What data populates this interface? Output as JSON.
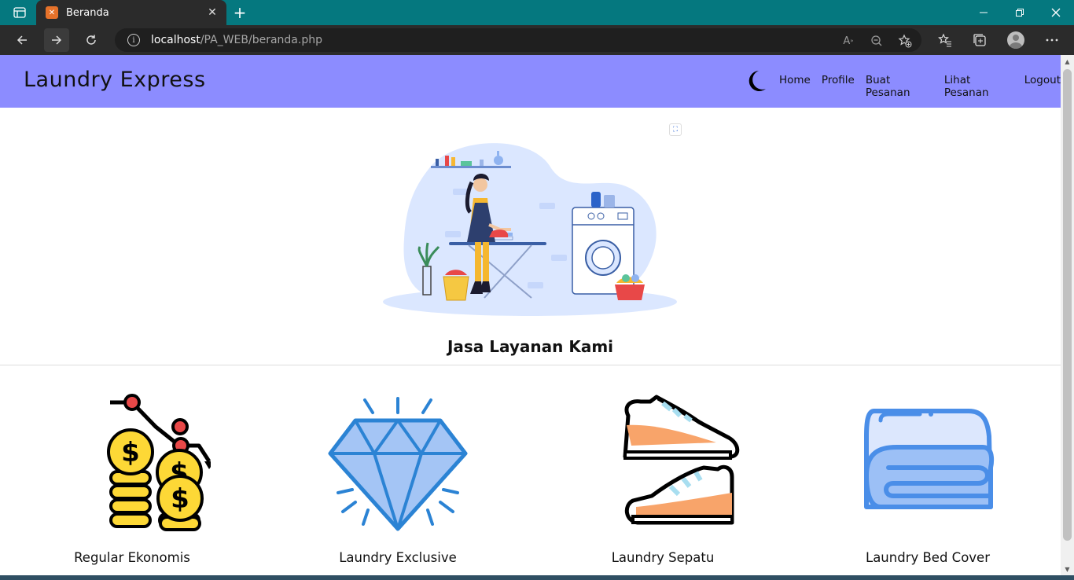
{
  "browser": {
    "tab_title": "Beranda",
    "url_host": "localhost",
    "url_path": "/PA_WEB/beranda.php"
  },
  "site": {
    "brand": "Laundry Express",
    "nav": [
      "Home",
      "Profile",
      "Buat Pesanan",
      "Lihat Pesanan",
      "Logout"
    ],
    "colors": {
      "header": "#8c8cff",
      "accent_blue": "#2b83d4",
      "gold": "#fdd836",
      "orange": "#f8a46a"
    }
  },
  "main": {
    "section_title": "Jasa Layanan Kami",
    "services": [
      {
        "label": "Regular Ekonomis",
        "icon": "coins-decline-icon"
      },
      {
        "label": "Laundry Exclusive",
        "icon": "diamond-icon"
      },
      {
        "label": "Laundry Sepatu",
        "icon": "sneakers-icon"
      },
      {
        "label": "Laundry Bed Cover",
        "icon": "folded-blanket-icon"
      }
    ]
  }
}
